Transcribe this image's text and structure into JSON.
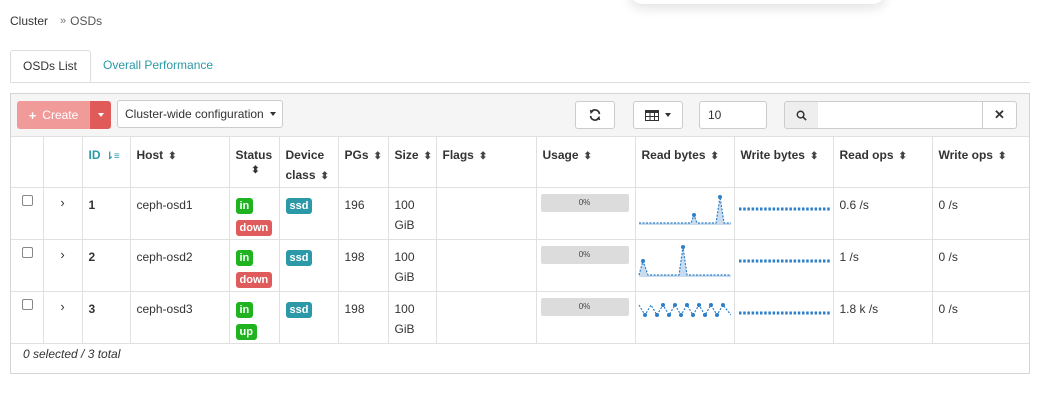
{
  "breadcrumb": {
    "root": "Cluster",
    "separator": "»",
    "current": "OSDs"
  },
  "tabs": [
    {
      "label": "OSDs List",
      "active": true
    },
    {
      "label": "Overall Performance",
      "active": false
    }
  ],
  "toolbar": {
    "create_label": "Create",
    "cluster_config_label": "Cluster-wide configuration",
    "page_size": "10",
    "search_placeholder": ""
  },
  "columns": [
    "",
    "",
    "ID",
    "Host",
    "Status",
    "Device class",
    "PGs",
    "Size",
    "Flags",
    "Usage",
    "Read bytes",
    "Write bytes",
    "Read ops",
    "Write ops"
  ],
  "rows": [
    {
      "id": "1",
      "host": "ceph-osd1",
      "status": [
        "in",
        "down"
      ],
      "status_colors": [
        "green",
        "red"
      ],
      "device_class": "ssd",
      "pgs": "196",
      "size": "100 GiB",
      "flags": "",
      "usage": "0%",
      "read_ops": "0.6 /s",
      "write_ops": "0 /s"
    },
    {
      "id": "2",
      "host": "ceph-osd2",
      "status": [
        "in",
        "down"
      ],
      "status_colors": [
        "green",
        "red"
      ],
      "device_class": "ssd",
      "pgs": "198",
      "size": "100 GiB",
      "flags": "",
      "usage": "0%",
      "read_ops": "1 /s",
      "write_ops": "0 /s"
    },
    {
      "id": "3",
      "host": "ceph-osd3",
      "status": [
        "in",
        "up"
      ],
      "status_colors": [
        "green",
        "green"
      ],
      "device_class": "ssd",
      "pgs": "198",
      "size": "100 GiB",
      "flags": "",
      "usage": "0%",
      "read_ops": "1.8 k /s",
      "write_ops": "0 /s"
    }
  ],
  "footer": {
    "summary": "0 selected / 3 total"
  },
  "colors": {
    "accent": "#2b99a8",
    "danger": "#e05c5c",
    "success": "#1fb41f",
    "sparkline": "#2c7fc8"
  },
  "icons": {
    "refresh": "refresh-icon",
    "columns": "table-columns-icon",
    "search": "search-icon",
    "clear": "close-icon",
    "sort": "sort-icon",
    "expand": "chevron-right-icon"
  }
}
